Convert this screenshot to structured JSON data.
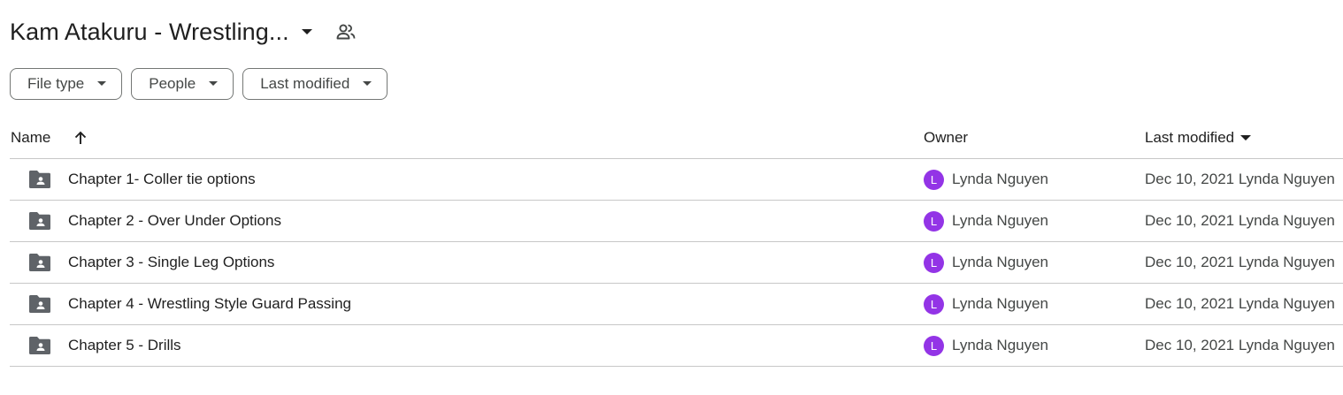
{
  "header": {
    "folder_title": "Kam Atakuru - Wrestling...",
    "caret_icon": "arrow-drop-down-icon",
    "shared_icon": "people-icon"
  },
  "filters": [
    {
      "label": "File type",
      "icon": "arrow-drop-down-icon"
    },
    {
      "label": "People",
      "icon": "arrow-drop-down-icon"
    },
    {
      "label": "Last modified",
      "icon": "arrow-drop-down-icon"
    }
  ],
  "table": {
    "columns": {
      "name": "Name",
      "owner": "Owner",
      "last_modified": "Last modified"
    },
    "sort_icon": "arrow-upward-icon",
    "rows": [
      {
        "name": "Chapter 1- Coller tie options",
        "owner": "Lynda Nguyen",
        "owner_initial": "L",
        "modified": "Dec 10, 2021 Lynda Nguyen"
      },
      {
        "name": "Chapter 2 - Over Under Options",
        "owner": "Lynda Nguyen",
        "owner_initial": "L",
        "modified": "Dec 10, 2021 Lynda Nguyen"
      },
      {
        "name": "Chapter 3 - Single Leg Options",
        "owner": "Lynda Nguyen",
        "owner_initial": "L",
        "modified": "Dec 10, 2021 Lynda Nguyen"
      },
      {
        "name": "Chapter 4 - Wrestling Style Guard Passing",
        "owner": "Lynda Nguyen",
        "owner_initial": "L",
        "modified": "Dec 10, 2021 Lynda Nguyen"
      },
      {
        "name": "Chapter 5 - Drills",
        "owner": "Lynda Nguyen",
        "owner_initial": "L",
        "modified": "Dec 10, 2021 Lynda Nguyen"
      }
    ]
  },
  "colors": {
    "avatar": "#9334e6",
    "folder_icon": "#5f6368",
    "border": "#c7c7c7",
    "text_primary": "#1f1f1f",
    "text_secondary": "#444746"
  }
}
